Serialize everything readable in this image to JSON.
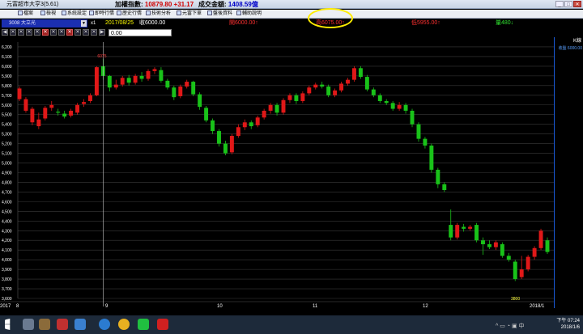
{
  "titlebar": {
    "app_title": "元富超市大亨3(5.61)",
    "index_label": "加權指數:",
    "index_value": "10879.80",
    "index_change": "+31.17",
    "volume_label": "成交金額:",
    "volume_value": "1408.59億",
    "window_buttons": [
      "_",
      "□",
      "✕"
    ]
  },
  "toolbar": {
    "items": [
      "檔案",
      "檢視",
      "系統設定",
      "即時行情",
      "歷史行情",
      "技術分析",
      "元富下單",
      "盤後資料",
      "輔助說明"
    ]
  },
  "quotebar": {
    "stock": "3008 大立光",
    "multiplier": "x1",
    "date": "2017/08/25",
    "close": "收6000.00",
    "open": "開6000.00↑",
    "high": "高6075.00↑",
    "low": "低5955.00↑",
    "volume": "量480↓"
  },
  "row2": {
    "price_input": "0.00"
  },
  "sidebox": {
    "header": "K線",
    "value": "收盤 6000.00"
  },
  "colors": {
    "up": "#e01818",
    "down": "#19c219",
    "grid": "#3a3a3a",
    "axis_text": "#ffffff",
    "highlight": "#ffec00",
    "crosshair": "#c8c8c8"
  },
  "chart_data": {
    "type": "candlestick",
    "title": "",
    "x_labels": [
      "2017",
      "8",
      "9",
      "10",
      "11",
      "12",
      "2018/1"
    ],
    "y_ticks": [
      3600,
      3700,
      3800,
      3900,
      4000,
      4100,
      4200,
      4300,
      4400,
      4500,
      4600,
      4700,
      4800,
      4900,
      5000,
      5100,
      5200,
      5300,
      5400,
      5500,
      5600,
      5700,
      5800,
      5900,
      6000,
      6100,
      6200
    ],
    "ylim": [
      3600,
      6250
    ],
    "crosshair_label": "6075",
    "bottom_label": "3800",
    "candles": [
      [
        5660,
        5770,
        5640,
        5790
      ],
      [
        5540,
        5660,
        5520,
        5680
      ],
      [
        5420,
        5560,
        5390,
        5580
      ],
      [
        5380,
        5450,
        5350,
        5520
      ],
      [
        5460,
        5570,
        5440,
        5590
      ],
      [
        5570,
        5600,
        5540,
        5640
      ],
      [
        5530,
        5520,
        5490,
        5560
      ],
      [
        5510,
        5480,
        5460,
        5540
      ],
      [
        5490,
        5540,
        5470,
        5560
      ],
      [
        5520,
        5600,
        5500,
        5620
      ],
      [
        5610,
        5630,
        5580,
        5660
      ],
      [
        5640,
        5700,
        5620,
        5720
      ],
      [
        5700,
        5990,
        5690,
        6000
      ],
      [
        6000,
        5900,
        5860,
        6075
      ],
      [
        5900,
        5780,
        5740,
        5910
      ],
      [
        5780,
        5810,
        5760,
        5860
      ],
      [
        5810,
        5880,
        5790,
        5900
      ],
      [
        5880,
        5830,
        5800,
        5910
      ],
      [
        5830,
        5900,
        5810,
        5920
      ],
      [
        5900,
        5870,
        5840,
        5940
      ],
      [
        5870,
        5950,
        5850,
        5970
      ],
      [
        5950,
        5970,
        5920,
        5990
      ],
      [
        5960,
        5850,
        5830,
        5990
      ],
      [
        5850,
        5780,
        5760,
        5870
      ],
      [
        5780,
        5680,
        5650,
        5800
      ],
      [
        5690,
        5790,
        5670,
        5810
      ],
      [
        5790,
        5840,
        5770,
        5860
      ],
      [
        5840,
        5710,
        5690,
        5850
      ],
      [
        5710,
        5580,
        5550,
        5730
      ],
      [
        5570,
        5440,
        5420,
        5590
      ],
      [
        5440,
        5330,
        5300,
        5460
      ],
      [
        5330,
        5200,
        5170,
        5350
      ],
      [
        5200,
        5100,
        5080,
        5230
      ],
      [
        5110,
        5280,
        5090,
        5300
      ],
      [
        5280,
        5370,
        5260,
        5400
      ],
      [
        5370,
        5420,
        5340,
        5450
      ],
      [
        5420,
        5380,
        5350,
        5440
      ],
      [
        5390,
        5470,
        5370,
        5490
      ],
      [
        5470,
        5540,
        5450,
        5560
      ],
      [
        5540,
        5600,
        5510,
        5620
      ],
      [
        5600,
        5520,
        5490,
        5620
      ],
      [
        5520,
        5650,
        5500,
        5670
      ],
      [
        5650,
        5700,
        5620,
        5720
      ],
      [
        5700,
        5640,
        5610,
        5720
      ],
      [
        5640,
        5720,
        5620,
        5740
      ],
      [
        5720,
        5780,
        5700,
        5800
      ],
      [
        5780,
        5810,
        5760,
        5830
      ],
      [
        5810,
        5790,
        5770,
        5840
      ],
      [
        5790,
        5700,
        5680,
        5810
      ],
      [
        5700,
        5750,
        5680,
        5770
      ],
      [
        5750,
        5820,
        5730,
        5840
      ],
      [
        5820,
        5860,
        5800,
        5880
      ],
      [
        5860,
        5980,
        5840,
        6000
      ],
      [
        5980,
        5890,
        5870,
        6000
      ],
      [
        5890,
        5760,
        5740,
        5910
      ],
      [
        5760,
        5700,
        5680,
        5780
      ],
      [
        5700,
        5640,
        5620,
        5720
      ],
      [
        5640,
        5620,
        5600,
        5660
      ],
      [
        5620,
        5560,
        5540,
        5640
      ],
      [
        5560,
        5600,
        5540,
        5630
      ],
      [
        5600,
        5540,
        5510,
        5620
      ],
      [
        5540,
        5400,
        5370,
        5560
      ],
      [
        5400,
        5250,
        5220,
        5420
      ],
      [
        5250,
        5180,
        5150,
        5270
      ],
      [
        5180,
        4930,
        4900,
        5200
      ],
      [
        4930,
        4780,
        4740,
        4950
      ],
      [
        4780,
        4720,
        4700,
        4800
      ],
      [
        4360,
        4230,
        4200,
        4520
      ],
      [
        4230,
        4360,
        4210,
        4380
      ],
      [
        4340,
        4320,
        4290,
        4370
      ],
      [
        4320,
        4340,
        4300,
        4360
      ],
      [
        4360,
        4200,
        4180,
        4380
      ],
      [
        4200,
        4160,
        4050,
        4230
      ],
      [
        4160,
        4130,
        4110,
        4200
      ],
      [
        4130,
        4180,
        4100,
        4200
      ],
      [
        4160,
        4040,
        4020,
        4180
      ],
      [
        4040,
        4000,
        3980,
        4070
      ],
      [
        3980,
        3800,
        3780,
        4000
      ],
      [
        3820,
        3900,
        3800,
        4040
      ],
      [
        3900,
        4030,
        3880,
        4050
      ],
      [
        4030,
        4120,
        4000,
        4140
      ],
      [
        4120,
        4300,
        4100,
        4320
      ],
      [
        4200,
        4080,
        4060,
        4230
      ]
    ]
  }
}
